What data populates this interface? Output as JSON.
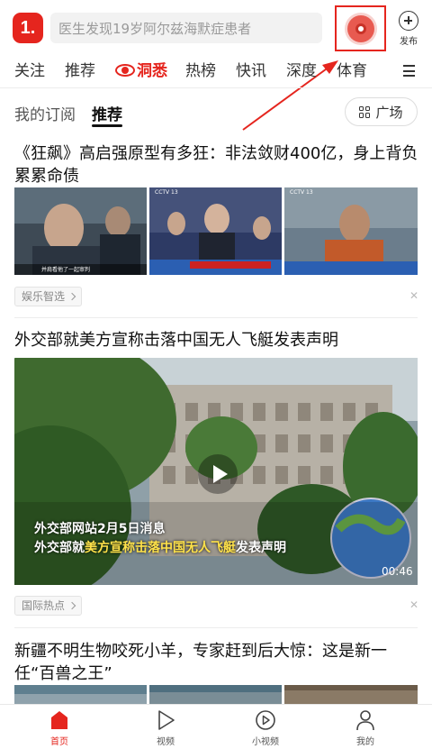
{
  "header": {
    "logo_text": "1.",
    "search_placeholder": "医生发现19岁阿尔兹海默症患者",
    "publish_label": "发布"
  },
  "channels": [
    {
      "label": "关注"
    },
    {
      "label": "推荐"
    },
    {
      "label": "洞悉",
      "highlight": true
    },
    {
      "label": "热榜"
    },
    {
      "label": "快讯"
    },
    {
      "label": "深度"
    },
    {
      "label": "体育"
    }
  ],
  "subtabs": {
    "subscriptions": "我的订阅",
    "recommended": "推荐",
    "plaza": "广场"
  },
  "articles": [
    {
      "title_line1": "《狂飙》高启强原型有多狂：非法敛财400亿，身上背负",
      "title_line2": "累累命债",
      "tag": "娱乐智选",
      "thumb_captions": [
        "并肩看他了一起审判",
        "CCTV 13",
        "CCTV 13"
      ]
    },
    {
      "title": "外交部就美方宣称击落中国无人飞艇发表声明",
      "tag": "国际热点",
      "video_caption1": "外交部网站2月5日消息",
      "video_caption2_pre": "外交部就",
      "video_caption2_hl": "美方宣称击落中国无人飞艇",
      "video_caption2_post": "发表声明",
      "duration": "00:46"
    },
    {
      "title_line1": "新疆不明生物咬死小羊，专家赶到后大惊：这是新一",
      "title_line2": "任“百兽之王”"
    }
  ],
  "bottom_nav": [
    {
      "label": "首页",
      "active": true
    },
    {
      "label": "视频"
    },
    {
      "label": "小视频"
    },
    {
      "label": "我的"
    }
  ],
  "colors": {
    "accent": "#e5251e"
  }
}
